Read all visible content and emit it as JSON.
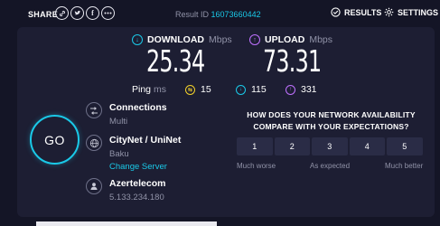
{
  "topbar": {
    "share_label": "SHARE",
    "share_icons": [
      "link-icon",
      "twitter-icon",
      "facebook-icon",
      "more-icon"
    ],
    "result_prefix": "Result ID",
    "result_id": "16073660442",
    "results_label": "RESULTS",
    "settings_label": "SETTINGS"
  },
  "download": {
    "label": "DOWNLOAD",
    "unit": "Mbps",
    "value": "25.34",
    "color": "#1ac9e8"
  },
  "upload": {
    "label": "UPLOAD",
    "unit": "Mbps",
    "value": "73.31",
    "color": "#bf71ff"
  },
  "ping": {
    "label": "Ping",
    "unit": "ms",
    "idle": "15",
    "download": "115",
    "upload": "331",
    "idle_color": "#f2d02a"
  },
  "go_label": "GO",
  "connections": {
    "title": "Connections",
    "value": "Multi"
  },
  "server": {
    "title": "CityNet / UniNet",
    "location": "Baku",
    "change_label": "Change Server"
  },
  "provider": {
    "title": "Azertelecom",
    "ip": "5.133.234.180"
  },
  "survey": {
    "question": "HOW DOES YOUR NETWORK AVAILABILITY COMPARE WITH YOUR EXPECTATIONS?",
    "options": [
      "1",
      "2",
      "3",
      "4",
      "5"
    ],
    "low_label": "Much worse",
    "mid_label": "As expected",
    "high_label": "Much better"
  }
}
